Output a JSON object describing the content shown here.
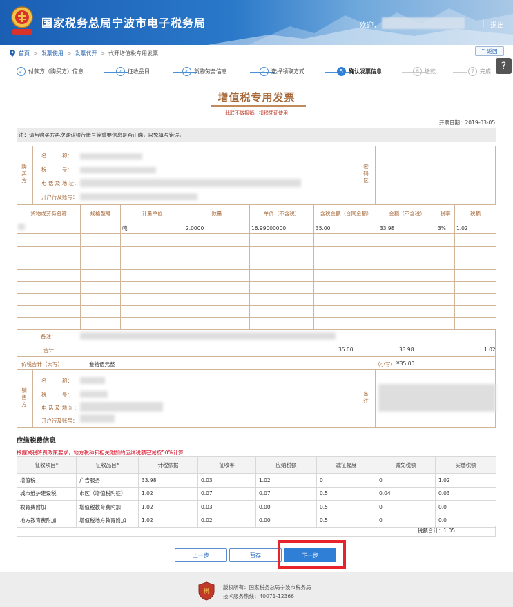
{
  "header": {
    "title": "国家税务总局宁波市电子税务局",
    "welcome": "欢迎，",
    "separator": "|",
    "logout": "退出",
    "colors": {
      "primary": "#1a5fb4",
      "accent": "#2f7fd6",
      "invoice_brown": "#a86a3a",
      "warning_red": "#d0021b"
    }
  },
  "breadcrumb": {
    "items": [
      "首页",
      "发票使用",
      "发票代开",
      "代开增值税专用发票"
    ],
    "separator": ">",
    "back_label": "返回"
  },
  "help_icon": "?",
  "steps": [
    {
      "label": "付款方（购买方）信息",
      "state": "done",
      "marker": "✓"
    },
    {
      "label": "征收品目",
      "state": "done",
      "marker": "✓"
    },
    {
      "label": "货物劳务信息",
      "state": "done",
      "marker": "✓"
    },
    {
      "label": "选择领取方式",
      "state": "done",
      "marker": "✓"
    },
    {
      "label": "确认发票信息",
      "state": "active",
      "marker": "5"
    },
    {
      "label": "缴款",
      "state": "todo",
      "marker": "6"
    },
    {
      "label": "完成",
      "state": "todo",
      "marker": "7"
    }
  ],
  "invoice": {
    "title": "增值税专用发票",
    "subtitle": "此联不做报销、扣税凭证使用",
    "date": "开票日期：2019-03-05",
    "notice": "注：请与购买方再次确认银行账号等重要信息是否正确，以免填写错误。",
    "buyer": {
      "side_label": [
        "购",
        "买",
        "方"
      ],
      "fields": [
        "名　　　称：",
        "税　　　号：",
        "电 话 及 地 址：",
        "开户行及账号："
      ]
    },
    "password_area": [
      "密",
      "码",
      "区"
    ],
    "columns": [
      "货物或劳务名称",
      "规格型号",
      "计量单位",
      "数量",
      "单价（不含税）",
      "含税金额（合同金额）",
      "金额（不含税）",
      "税率",
      "税额"
    ],
    "rows": [
      [
        "",
        "",
        "吨",
        "2.0000",
        "16.99000000",
        "35.00",
        "33.98",
        "3%",
        "1.02"
      ]
    ],
    "empty_rows": 8,
    "remark_label": "备注：",
    "total_label": "合计",
    "total_amount_taxed": "35.00",
    "total_amount": "33.98",
    "total_tax": "1.02",
    "grand_label": "价税合计（大写）",
    "grand_words": "叁拾伍元整",
    "grand_small_label": "（小写）",
    "grand_small": "¥35.00",
    "seller": {
      "side_label": [
        "销",
        "售",
        "方"
      ],
      "fields": [
        "名　　　称：",
        "税　　　号：",
        "电 话 及 地 址：",
        "开户行及账号："
      ],
      "remark_side": [
        "备",
        "注"
      ]
    }
  },
  "tax_section": {
    "title": "应缴税费信息",
    "warning": "根据减税降费政策要求，地方税种和相关附加的应纳税额已减按50%计算",
    "columns": [
      "征收项目*",
      "征收品目*",
      "计税依据",
      "征收率",
      "应纳税额",
      "减征幅度",
      "减免税额",
      "实缴税额"
    ],
    "rows": [
      [
        "增值税",
        "广告服务",
        "33.98",
        "0.03",
        "1.02",
        "0",
        "0",
        "1.02"
      ],
      [
        "城市维护建设税",
        "市区（增值税附征）",
        "1.02",
        "0.07",
        "0.07",
        "0.5",
        "0.04",
        "0.03"
      ],
      [
        "教育费附加",
        "增值税教育费附加",
        "1.02",
        "0.03",
        "0.00",
        "0.5",
        "0",
        "0.0"
      ],
      [
        "地方教育费附加",
        "增值税地方教育附加",
        "1.02",
        "0.02",
        "0.00",
        "0.5",
        "0",
        "0.0"
      ]
    ],
    "total": "税额合计：1.05"
  },
  "actions": {
    "prev": "上一步",
    "save": "暂存",
    "next": "下一步"
  },
  "footer": {
    "copyright": "版权所有：国家税务总局宁波市税务局",
    "hotline": "技术服务热线：40071-12366",
    "logo_text": "税"
  }
}
